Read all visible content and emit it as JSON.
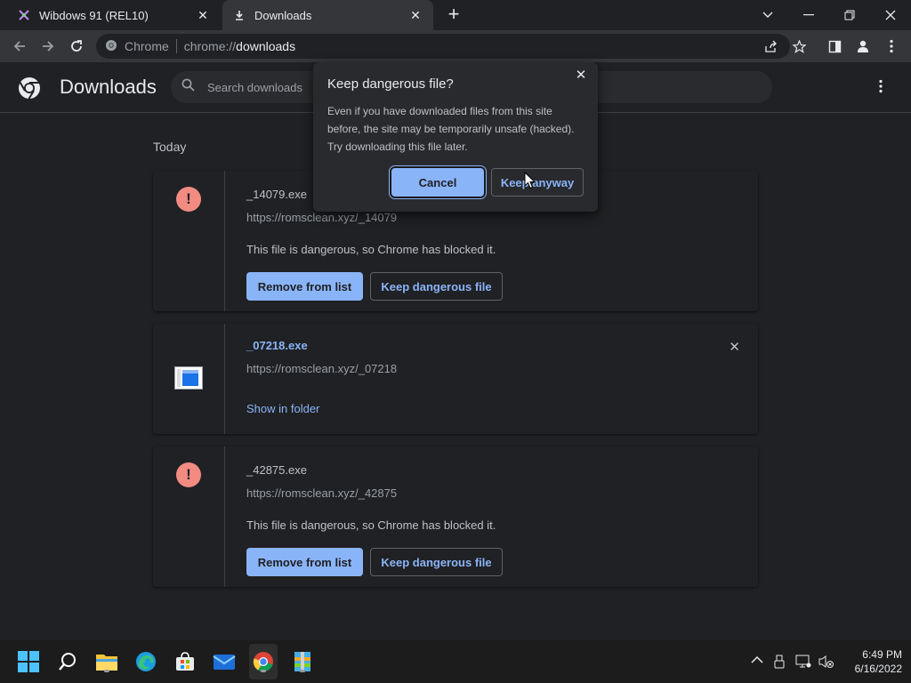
{
  "browser": {
    "tabs": [
      {
        "title": "Wibdows 91 (REL10)",
        "active": false
      },
      {
        "title": "Downloads",
        "active": true
      }
    ],
    "new_tab_label": "+",
    "omnibox": {
      "site_label": "Chrome",
      "url_prefix": "chrome://",
      "url_path": "downloads"
    }
  },
  "downloads_page": {
    "title": "Downloads",
    "search_placeholder": "Search downloads",
    "section_label": "Today",
    "items": [
      {
        "filename": "_14079.exe",
        "url": "https://romsclean.xyz/_14079",
        "status": "This file is dangerous, so Chrome has blocked it.",
        "remove_label": "Remove from list",
        "keep_label": "Keep dangerous file",
        "icon": "warning-icon"
      },
      {
        "filename": "_07218.exe",
        "url": "https://romsclean.xyz/_07218",
        "show_in_folder_label": "Show in folder",
        "icon": "exe-file-icon"
      },
      {
        "filename": "_42875.exe",
        "url": "https://romsclean.xyz/_42875",
        "status": "This file is dangerous, so Chrome has blocked it.",
        "remove_label": "Remove from list",
        "keep_label": "Keep dangerous file",
        "icon": "warning-icon"
      }
    ]
  },
  "dialog": {
    "title": "Keep dangerous file?",
    "body": "Even if you have downloaded files from this site before, the site may be temporarily unsafe (hacked). Try downloading this file later.",
    "cancel_label": "Cancel",
    "keep_anyway_label": "Keep anyway"
  },
  "taskbar": {
    "time": "6:49 PM",
    "date": "6/16/2022",
    "apps": [
      "start-icon",
      "search-icon",
      "file-explorer-icon",
      "edge-icon",
      "store-icon",
      "mail-icon",
      "chrome-icon",
      "winrar-icon"
    ]
  },
  "colors": {
    "accent": "#8ab4f8",
    "danger": "#f28b82",
    "background": "#202124"
  }
}
